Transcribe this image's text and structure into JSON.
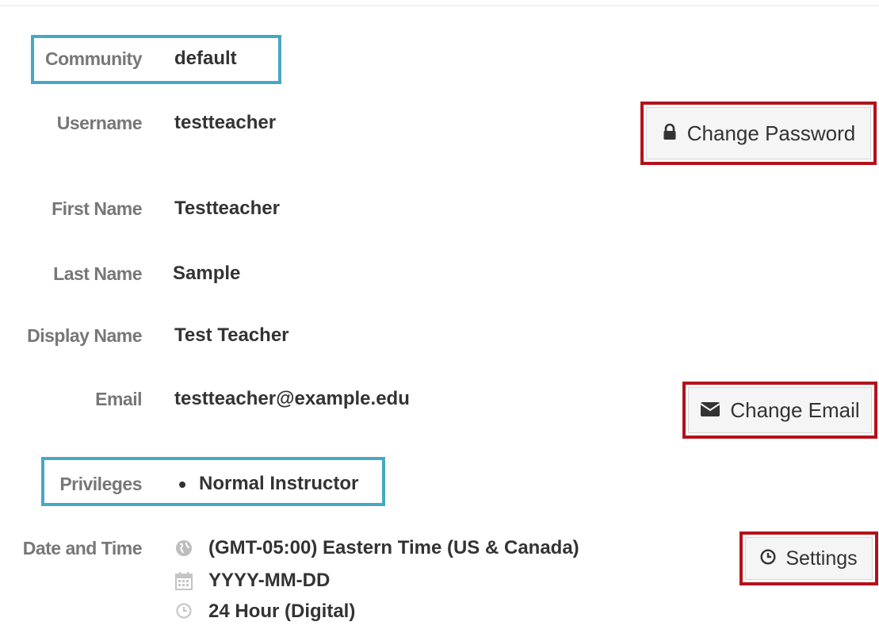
{
  "fields": {
    "community": {
      "label": "Community",
      "value": "default"
    },
    "username": {
      "label": "Username",
      "value": "testteacher"
    },
    "first_name": {
      "label": "First Name",
      "value": "Testteacher"
    },
    "last_name": {
      "label": "Last Name",
      "value": "Sample"
    },
    "display_name": {
      "label": "Display Name",
      "value": "Test Teacher"
    },
    "email": {
      "label": "Email",
      "value": "testteacher@example.edu"
    },
    "privileges": {
      "label": "Privileges",
      "items": [
        "Normal Instructor"
      ]
    },
    "date_time": {
      "label": "Date and Time",
      "timezone": "(GMT-05:00) Eastern Time (US & Canada)",
      "date_format": "YYYY-MM-DD",
      "time_format": "24 Hour (Digital)"
    }
  },
  "buttons": {
    "change_password": "Change Password",
    "change_email": "Change Email",
    "settings": "Settings"
  },
  "icons": {
    "password": "lock-icon",
    "email": "envelope-icon",
    "settings": "clock-icon",
    "timezone": "globe-icon",
    "date_format": "calendar-icon",
    "time_format": "clock-icon"
  },
  "colors": {
    "highlight_blue": "#46a8c4",
    "highlight_red": "#b3121b",
    "label": "#777777",
    "value": "#333333"
  }
}
